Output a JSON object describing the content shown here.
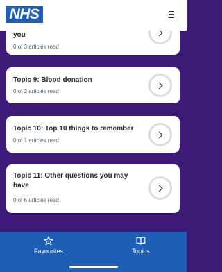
{
  "header": {
    "logo": "NHS",
    "menu_icon": "hamburger-menu-icon"
  },
  "topics": [
    {
      "title": "you",
      "progress": "0 of 3 articles read"
    },
    {
      "title": "Topic 9: Blood donation",
      "progress": "0 of 2 articles read"
    },
    {
      "title": "Topic 10: Top 10 things to remember",
      "progress": "0 of 1 articles read"
    },
    {
      "title": "Topic 11: Other questions you may have",
      "progress": "0 of 6 articles read"
    }
  ],
  "tabbar": {
    "favourites_label": "Favourites",
    "favourites_icon": "star-icon",
    "topics_label": "Topics",
    "topics_icon": "book-icon"
  },
  "colors": {
    "background": "#3d1a78",
    "nhs_blue": "#1d5fb8",
    "card": "#ffffff",
    "chevron_ring": "#d8dde0"
  }
}
